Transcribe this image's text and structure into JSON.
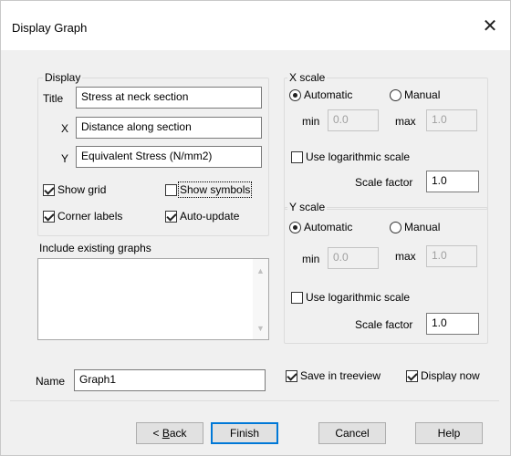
{
  "window": {
    "title": "Display Graph",
    "close_icon": "close-icon"
  },
  "display": {
    "group_label": "Display",
    "title_label": "Title",
    "title_value": "Stress at neck section",
    "x_label": "X",
    "x_value": "Distance along section",
    "y_label": "Y",
    "y_value": "Equivalent Stress (N/mm2)",
    "show_grid": {
      "label": "Show grid",
      "checked": true
    },
    "show_symbols": {
      "label": "Show symbols",
      "checked": false
    },
    "corner_labels": {
      "label": "Corner labels",
      "checked": true
    },
    "auto_update": {
      "label": "Auto-update",
      "checked": true
    }
  },
  "include_existing": {
    "label": "Include existing graphs",
    "items": []
  },
  "x_scale": {
    "group_label": "X scale",
    "automatic_label": "Automatic",
    "manual_label": "Manual",
    "selected": "automatic",
    "min_label": "min",
    "min_value": "0.0",
    "max_label": "max",
    "max_value": "1.0",
    "log_label": "Use logarithmic scale",
    "log_checked": false,
    "scale_factor_label": "Scale factor",
    "scale_factor_value": "1.0"
  },
  "y_scale": {
    "group_label": "Y scale",
    "automatic_label": "Automatic",
    "manual_label": "Manual",
    "selected": "automatic",
    "min_label": "min",
    "min_value": "0.0",
    "max_label": "max",
    "max_value": "1.0",
    "log_label": "Use logarithmic scale",
    "log_checked": false,
    "scale_factor_label": "Scale factor",
    "scale_factor_value": "1.0"
  },
  "name": {
    "label": "Name",
    "value": "Graph1"
  },
  "save_in_treeview": {
    "label": "Save in treeview",
    "checked": true
  },
  "display_now": {
    "label": "Display now",
    "checked": true
  },
  "buttons": {
    "back_prefix": "< ",
    "back_mnemonic": "B",
    "back_rest": "ack",
    "finish": "Finish",
    "cancel": "Cancel",
    "help": "Help"
  }
}
